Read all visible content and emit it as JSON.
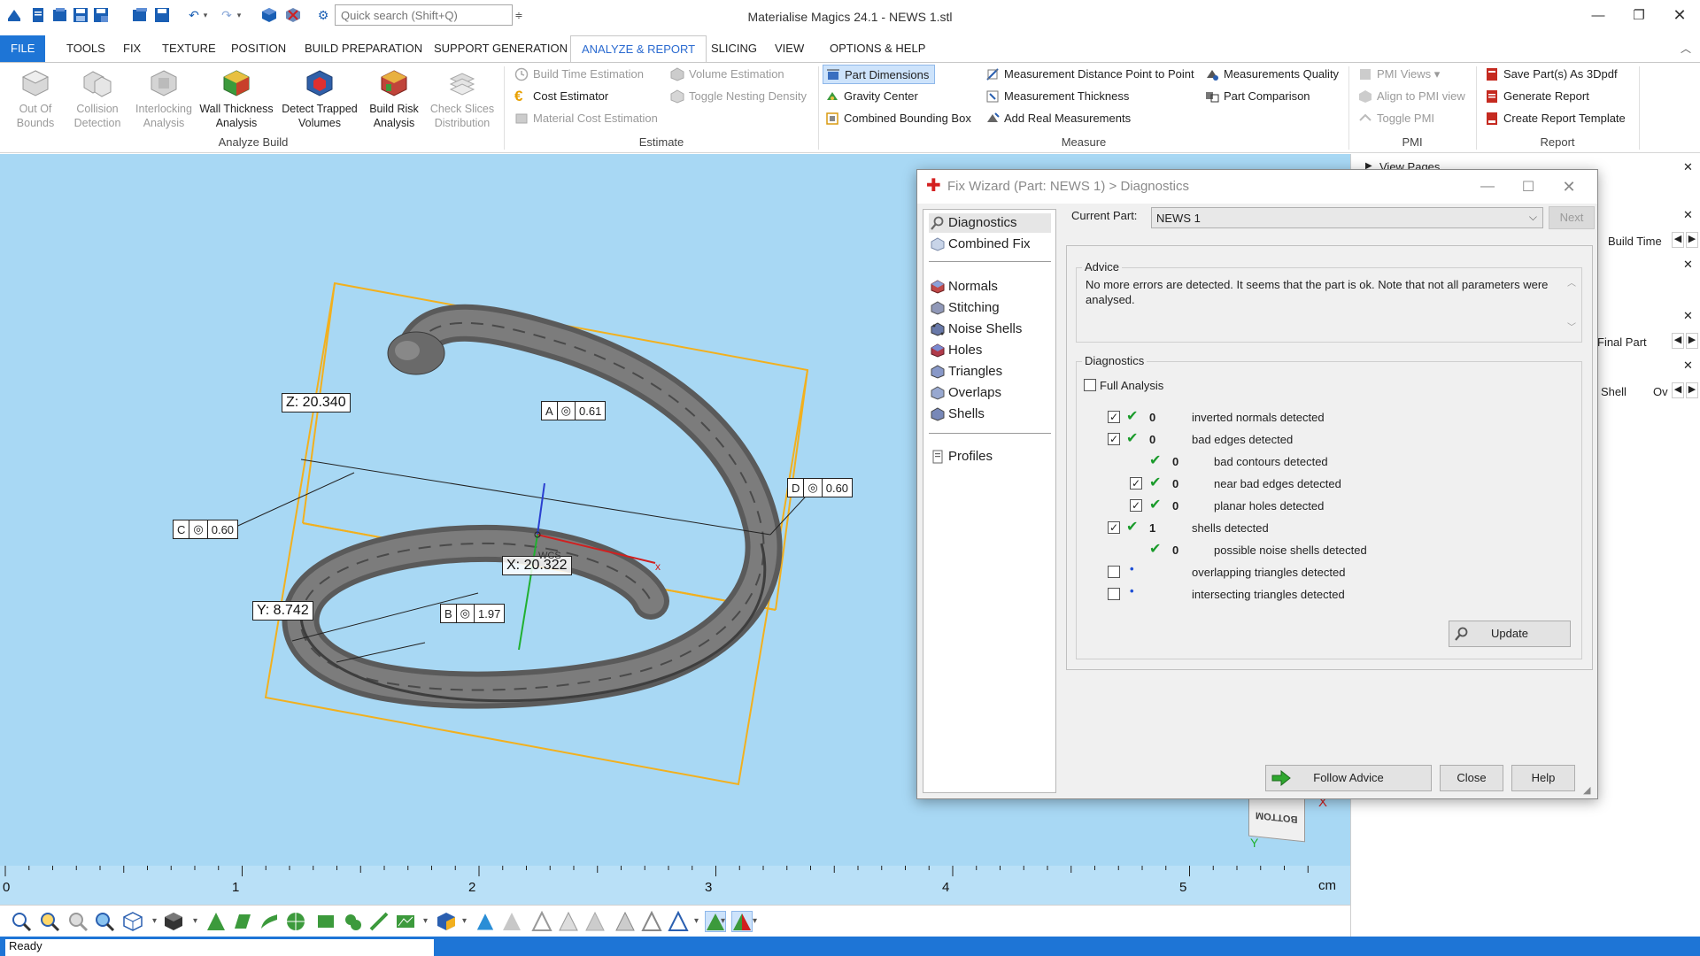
{
  "window": {
    "title": "Materialise Magics 24.1 - NEWS 1.stl",
    "quick_search_placeholder": "Quick search (Shift+Q)"
  },
  "ribbon_tabs": [
    "FILE",
    "TOOLS",
    "FIX",
    "TEXTURE",
    "POSITION",
    "BUILD PREPARATION",
    "SUPPORT GENERATION",
    "ANALYZE & REPORT",
    "SLICING",
    "VIEW",
    "OPTIONS & HELP"
  ],
  "active_tab": "ANALYZE & REPORT",
  "ribbon": {
    "analyze_build": {
      "label": "Analyze Build",
      "buttons": [
        {
          "label1": "Out Of",
          "label2": "Bounds",
          "enabled": false
        },
        {
          "label1": "Collision",
          "label2": "Detection",
          "enabled": false
        },
        {
          "label1": "Interlocking",
          "label2": "Analysis",
          "enabled": false
        },
        {
          "label1": "Wall Thickness",
          "label2": "Analysis",
          "enabled": true
        },
        {
          "label1": "Detect Trapped",
          "label2": "Volumes",
          "enabled": true
        },
        {
          "label1": "Build Risk",
          "label2": "Analysis",
          "enabled": true
        },
        {
          "label1": "Check Slices",
          "label2": "Distribution",
          "enabled": false
        }
      ]
    },
    "estimate": {
      "label": "Estimate",
      "build_time": "Build Time Estimation",
      "cost": "Cost Estimator",
      "material_cost": "Material Cost Estimation",
      "volume": "Volume Estimation",
      "nesting": "Toggle Nesting Density"
    },
    "measure": {
      "label": "Measure",
      "part_dimensions": "Part Dimensions",
      "gravity_center": "Gravity Center",
      "combined_bbox": "Combined Bounding Box",
      "dist_point": "Measurement Distance Point to Point",
      "thickness": "Measurement Thickness",
      "real_meas": "Add Real Measurements",
      "quality": "Measurements Quality",
      "comparison": "Part Comparison"
    },
    "pmi": {
      "label": "PMI",
      "views": "PMI Views",
      "align": "Align to PMI view",
      "toggle": "Toggle PMI"
    },
    "report": {
      "label": "Report",
      "save3d": "Save Part(s) As 3Dpdf",
      "generate": "Generate Report",
      "template": "Create Report Template"
    }
  },
  "viewport": {
    "z_label": "Z: 20.340",
    "y_label": "Y: 8.742",
    "x_label": "X: 20.322",
    "wcs": "WCS",
    "tag_a": {
      "letter": "A",
      "sym": "◎",
      "value": "0.61"
    },
    "tag_b": {
      "letter": "B",
      "sym": "◎",
      "value": "1.97"
    },
    "tag_c": {
      "letter": "C",
      "sym": "◎",
      "value": "0.60"
    },
    "tag_d": {
      "letter": "D",
      "sym": "◎",
      "value": "0.60"
    },
    "ruler": [
      "0",
      "1",
      "2",
      "3",
      "4",
      "5"
    ],
    "ruler_unit": "cm",
    "cube_face": "BOTTOM",
    "axis_x": "X",
    "axis_y": "Y"
  },
  "right_dock": {
    "view_pages": "View Pages",
    "build_time": "Build Time",
    "final_part": "Final Part",
    "shell": "Shell",
    "ov": "Ov"
  },
  "status": "Ready",
  "dialog": {
    "title": "Fix Wizard (Part: NEWS 1) > Diagnostics",
    "nav": {
      "diagnostics": "Diagnostics",
      "combined_fix": "Combined Fix",
      "normals": "Normals",
      "stitching": "Stitching",
      "noise_shells": "Noise Shells",
      "holes": "Holes",
      "triangles": "Triangles",
      "overlaps": "Overlaps",
      "shells": "Shells",
      "profiles": "Profiles"
    },
    "current_part_label": "Current Part:",
    "current_part": "NEWS 1",
    "next": "Next",
    "advice_title": "Advice",
    "advice_text": "No more errors are detected. It seems that the part is ok. Note that not all parameters were analysed.",
    "diag_title": "Diagnostics",
    "full_analysis": "Full Analysis",
    "rows": [
      {
        "count": "0",
        "text": "inverted normals detected",
        "checked": true,
        "status": "ok"
      },
      {
        "count": "0",
        "text": "bad edges detected",
        "checked": true,
        "status": "ok"
      },
      {
        "count": "0",
        "text": "bad contours detected",
        "checked": null,
        "status": "ok"
      },
      {
        "count": "0",
        "text": "near bad edges detected",
        "checked": true,
        "status": "ok"
      },
      {
        "count": "0",
        "text": "planar holes detected",
        "checked": true,
        "status": "ok"
      },
      {
        "count": "1",
        "text": "shells detected",
        "checked": true,
        "status": "ok"
      },
      {
        "count": "0",
        "text": "possible noise shells detected",
        "checked": null,
        "status": "ok"
      },
      {
        "count": "",
        "text": "overlapping triangles detected",
        "checked": false,
        "status": "dot"
      },
      {
        "count": "",
        "text": "intersecting triangles detected",
        "checked": false,
        "status": "dot"
      }
    ],
    "update": "Update",
    "follow_advice": "Follow Advice",
    "close": "Close",
    "help": "Help"
  },
  "colors": {
    "accent": "#1e75d6",
    "viewport_bg": "#a8d8f4",
    "bbox": "#f2b01e",
    "ok_tick": "#1a9b2b"
  }
}
